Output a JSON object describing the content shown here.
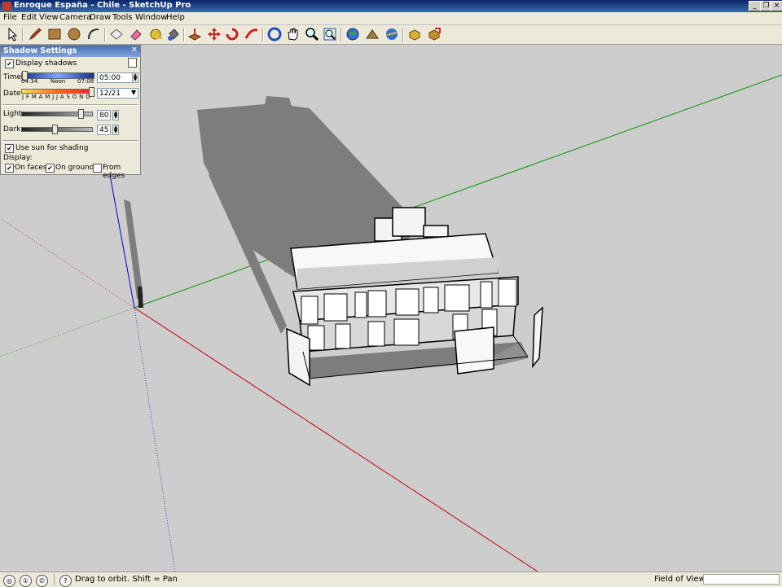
{
  "window": {
    "title": "Enroque España - Chile - SketchUp Pro"
  },
  "menu": [
    "File",
    "Edit",
    "View",
    "Camera",
    "Draw",
    "Tools",
    "Window",
    "Help"
  ],
  "toolbar": {
    "tools": [
      "select-icon",
      "pencil-icon",
      "rectangle-icon",
      "circle-icon",
      "arc-icon",
      "eraser-icon",
      "paint-bucket-icon",
      "push-pull-icon",
      "move-icon",
      "rotate-icon",
      "offset-icon",
      "orbit-icon",
      "pan-icon",
      "zoom-icon",
      "zoom-extents-icon",
      "add-location-icon",
      "toggle-terrain-icon",
      "get-models-icon",
      "share-model-icon",
      "get-components-icon"
    ]
  },
  "shadow_panel": {
    "title": "Shadow Settings",
    "display_shadows_label": "Display shadows",
    "display_shadows": true,
    "time_label": "Time",
    "time_sunrise": "04:34",
    "time_noon": "Noon",
    "time_sunset": "07:08",
    "time_value": "05:00",
    "date_label": "Date",
    "date_months": "J F M A M J J A S O N D",
    "date_value": "12/21",
    "light_label": "Light",
    "light_value": "80",
    "dark_label": "Dark",
    "dark_value": "45",
    "use_sun_label": "Use sun for shading",
    "use_sun": true,
    "display_label": "Display:",
    "on_faces_label": "On faces",
    "on_faces": true,
    "on_ground_label": "On ground",
    "on_ground": true,
    "from_edges_label": "From edges",
    "from_edges": false
  },
  "status": {
    "message": "Drag to orbit.  Shift = Pan",
    "measurement_label": "Field of View",
    "measurement_value": ""
  },
  "colors": {
    "title_bar": "#0a246a",
    "viewport_bg": "#cdcdcd",
    "shadow": "#7d7d7d",
    "red_axis": "#c80000",
    "green_axis": "#009600",
    "blue_axis": "#0000c8"
  }
}
